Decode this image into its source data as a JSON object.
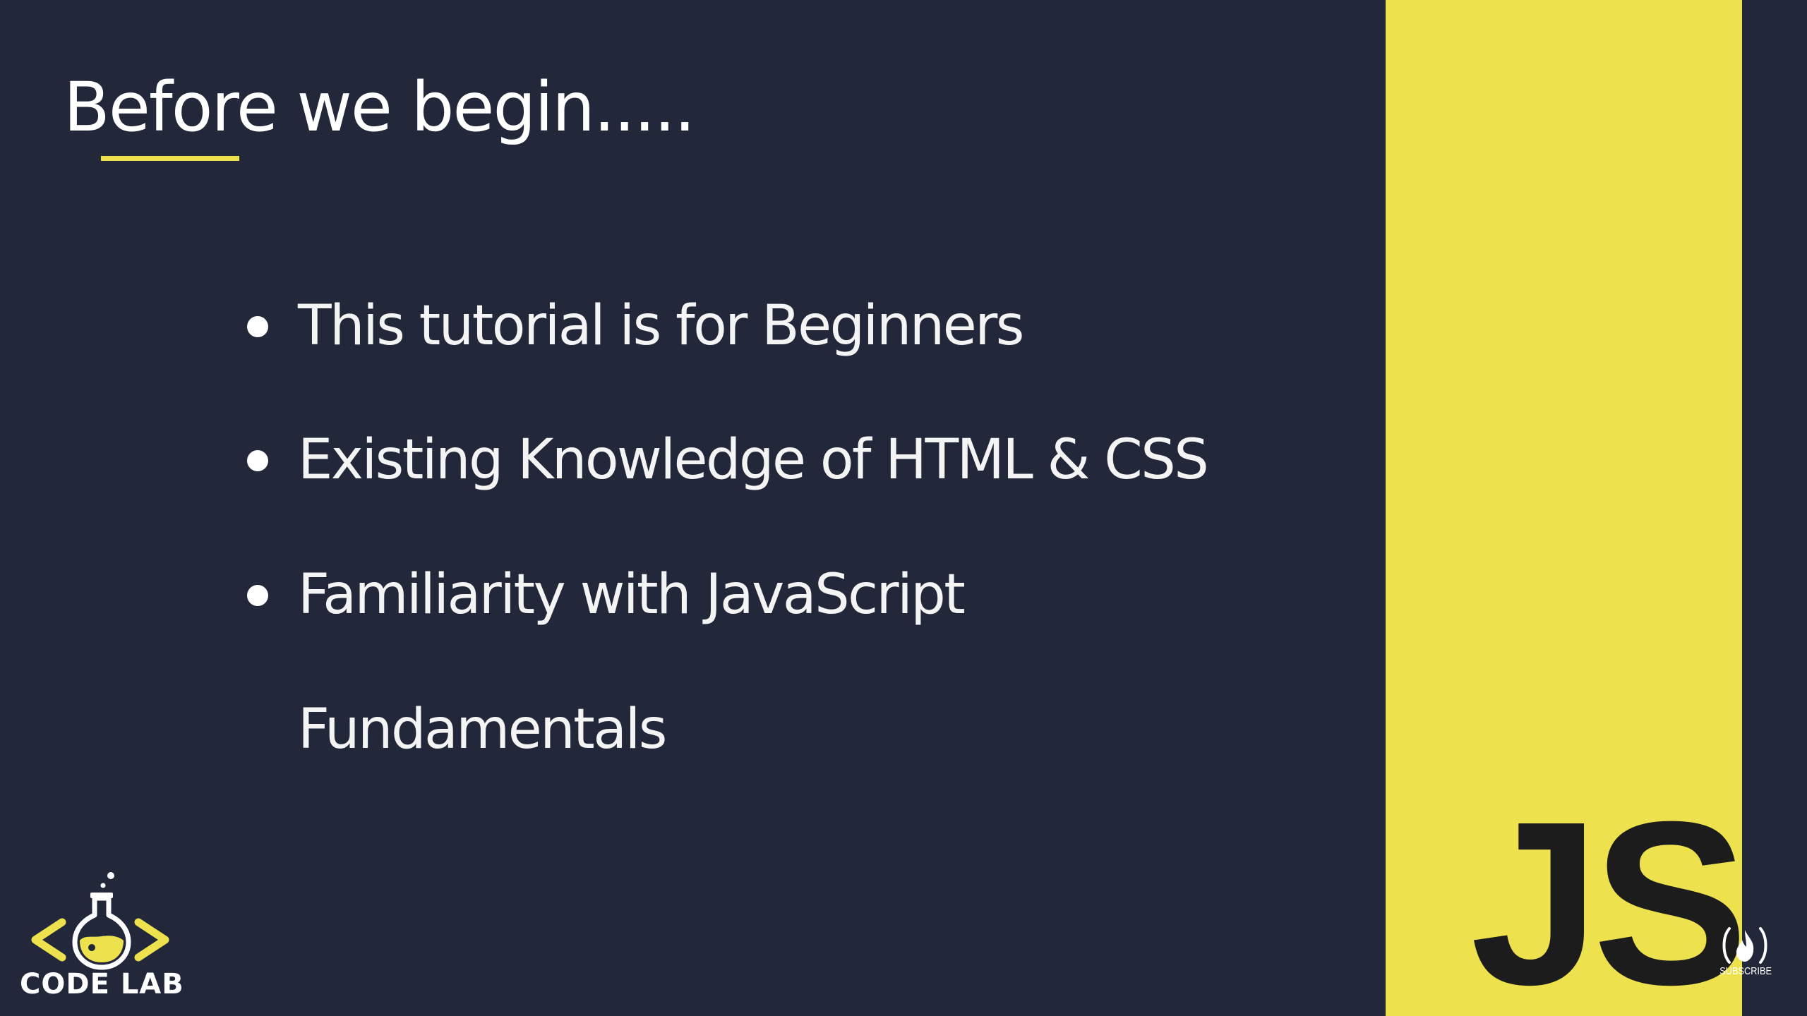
{
  "slide": {
    "title": "Before we begin.....",
    "bullets": [
      {
        "text": "This tutorial is for Beginners"
      },
      {
        "text": "Existing Knowledge of HTML & CSS"
      },
      {
        "text": "Familiarity with JavaScript"
      }
    ],
    "continuation": "Fundamentals"
  },
  "brand": {
    "logo_text": "CODE LAB",
    "logo_icon": "flask-code-brackets-icon"
  },
  "panel": {
    "mark": "JS"
  },
  "watermark": {
    "label": "SUBSCRIBE",
    "icon": "fire-icon"
  },
  "colors": {
    "background": "#22283a",
    "accent": "#ede14d",
    "text": "#f4f4f4",
    "mark": "#1c1c1c"
  }
}
